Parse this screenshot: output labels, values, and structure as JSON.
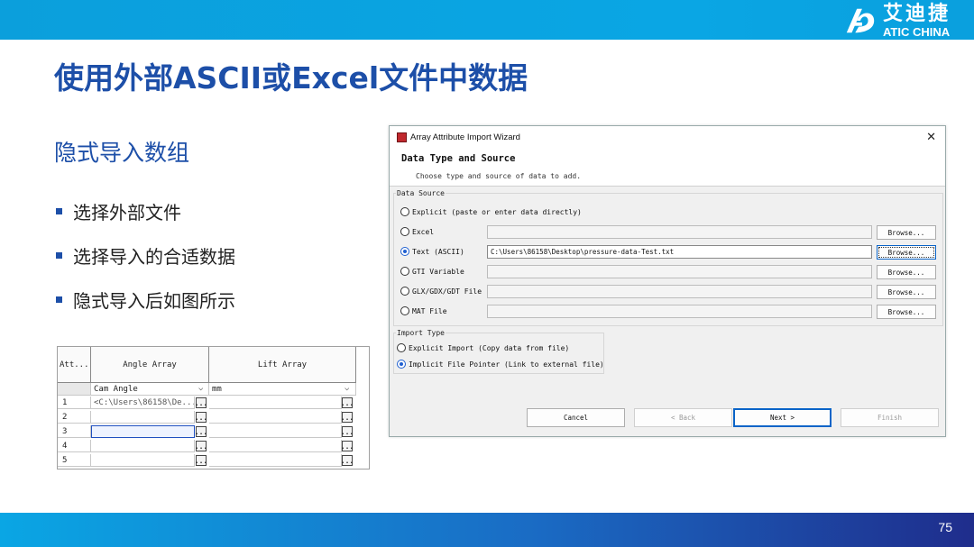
{
  "header": {
    "logo_cn": "艾迪捷",
    "logo_en": "ATIC CHINA"
  },
  "slide": {
    "title": "使用外部ASCII或Excel文件中数据",
    "subtitle": "隐式导入数组",
    "bullets": [
      "选择外部文件",
      "选择导入的合适数据",
      "隐式导入后如图所示"
    ],
    "page_number": "75"
  },
  "grid": {
    "headers": [
      "Att...",
      "Angle Array",
      "Lift Array"
    ],
    "unit_row": [
      "Cam Angle",
      "mm"
    ],
    "rows": [
      {
        "no": "1",
        "angle": "<C:\\Users\\86158\\De...",
        "lift": ""
      },
      {
        "no": "2",
        "angle": "",
        "lift": ""
      },
      {
        "no": "3",
        "angle": "",
        "lift": ""
      },
      {
        "no": "4",
        "angle": "",
        "lift": ""
      },
      {
        "no": "5",
        "angle": "",
        "lift": ""
      }
    ],
    "ellipsis": "..."
  },
  "dialog": {
    "window_title": "Array Attribute Import Wizard",
    "close_glyph": "✕",
    "heading": "Data Type and Source",
    "subheading": "Choose type and source of data to add.",
    "data_source_label": "Data Source",
    "sources": [
      {
        "label": "Explicit (paste or enter data directly)",
        "selected": false,
        "path": null
      },
      {
        "label": "Excel",
        "selected": false,
        "path": ""
      },
      {
        "label": "Text (ASCII)",
        "selected": true,
        "path": "C:\\Users\\86158\\Desktop\\pressure-data-Test.txt"
      },
      {
        "label": "GTI Variable",
        "selected": false,
        "path": ""
      },
      {
        "label": "GLX/GDX/GDT File",
        "selected": false,
        "path": ""
      },
      {
        "label": "MAT File",
        "selected": false,
        "path": ""
      }
    ],
    "browse_label": "Browse...",
    "import_type_label": "Import Type",
    "import_types": [
      {
        "label": "Explicit Import (Copy data from file)",
        "selected": false
      },
      {
        "label": "Implicit File Pointer (Link to external file)",
        "selected": true
      }
    ],
    "buttons": {
      "cancel": "Cancel",
      "back": "< Back",
      "next": "Next >",
      "finish": "Finish"
    }
  },
  "colors": {
    "brand_blue": "#1d4fa8",
    "bar_cyan": "#0aa6e4",
    "bar_navy": "#1f2d8c",
    "radio_selected": "#1f5fd0"
  }
}
